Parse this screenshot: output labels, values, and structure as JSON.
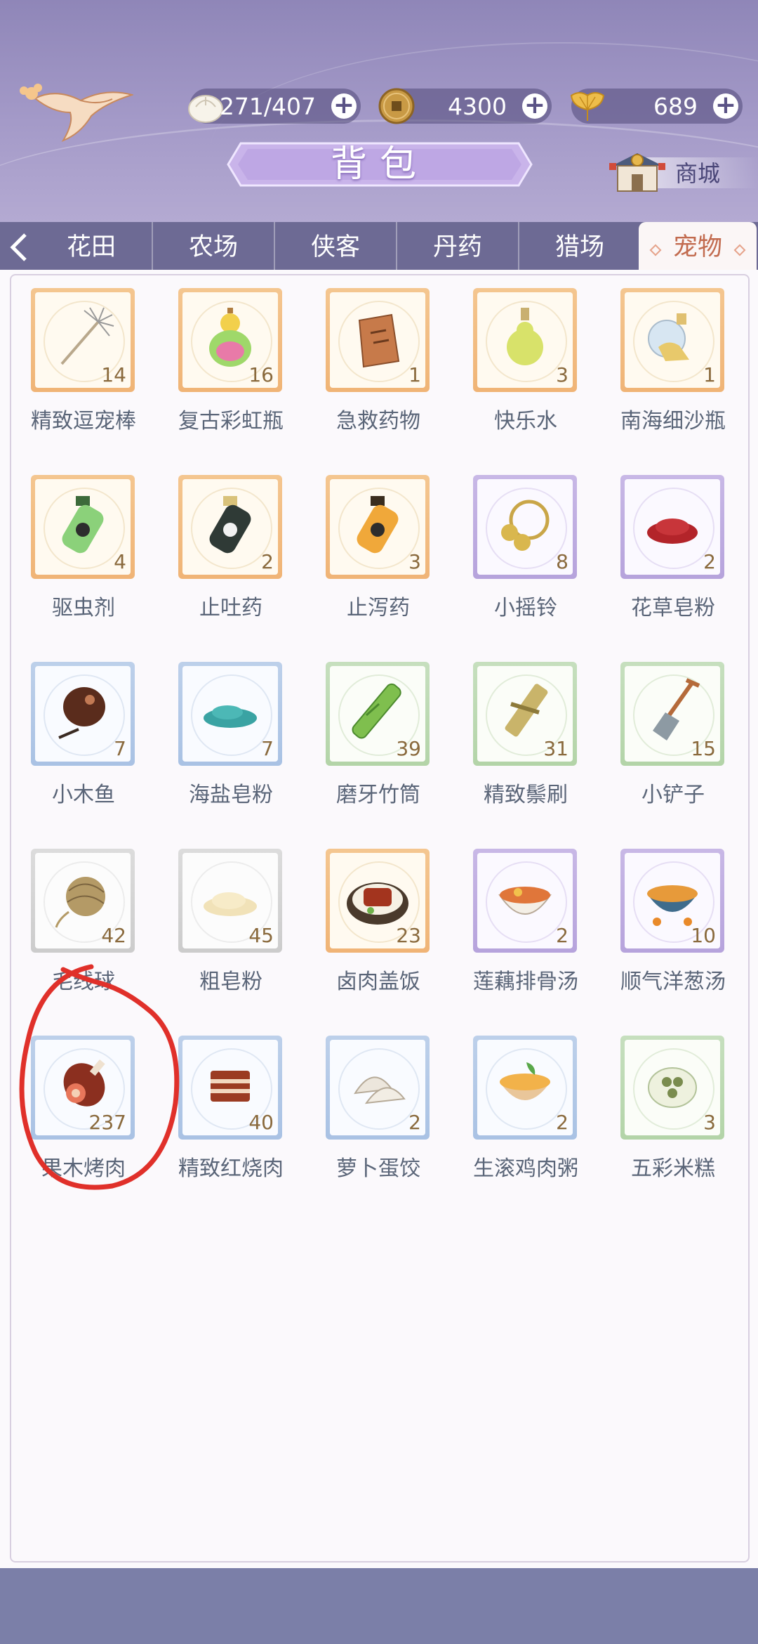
{
  "header": {
    "title": "背包",
    "shop_label": "商城",
    "resources": [
      {
        "icon": "bun-icon",
        "value": "271/407"
      },
      {
        "icon": "coin-icon",
        "value": "4300"
      },
      {
        "icon": "ginkgo-leaf-icon",
        "value": "689"
      }
    ]
  },
  "tabs": [
    {
      "label": "花田",
      "active": false
    },
    {
      "label": "农场",
      "active": false
    },
    {
      "label": "侠客",
      "active": false
    },
    {
      "label": "丹药",
      "active": false
    },
    {
      "label": "猎场",
      "active": false
    },
    {
      "label": "宠物",
      "active": true
    }
  ],
  "items": [
    {
      "name": "精致逗宠棒",
      "count": "14",
      "tier": "gold",
      "icon": "feather-wand-icon"
    },
    {
      "name": "复古彩虹瓶",
      "count": "16",
      "tier": "gold",
      "icon": "rainbow-gourd-icon"
    },
    {
      "name": "急救药物",
      "count": "1",
      "tier": "gold",
      "icon": "medicine-pack-icon"
    },
    {
      "name": "快乐水",
      "count": "3",
      "tier": "gold",
      "icon": "green-flask-icon"
    },
    {
      "name": "南海细沙瓶",
      "count": "1",
      "tier": "gold",
      "icon": "sand-bottle-icon"
    },
    {
      "name": "驱虫剂",
      "count": "4",
      "tier": "gold",
      "icon": "green-bottle-icon"
    },
    {
      "name": "止吐药",
      "count": "2",
      "tier": "gold",
      "icon": "black-bottle-icon"
    },
    {
      "name": "止泻药",
      "count": "3",
      "tier": "gold",
      "icon": "orange-bottle-icon"
    },
    {
      "name": "小摇铃",
      "count": "8",
      "tier": "purple",
      "icon": "bell-icon"
    },
    {
      "name": "花草皂粉",
      "count": "2",
      "tier": "purple",
      "icon": "red-powder-icon"
    },
    {
      "name": "小木鱼",
      "count": "7",
      "tier": "blue",
      "icon": "wooden-fish-icon"
    },
    {
      "name": "海盐皂粉",
      "count": "7",
      "tier": "blue",
      "icon": "teal-powder-icon"
    },
    {
      "name": "磨牙竹筒",
      "count": "39",
      "tier": "green",
      "icon": "bamboo-tube-icon"
    },
    {
      "name": "精致鬃刷",
      "count": "31",
      "tier": "green",
      "icon": "brush-icon"
    },
    {
      "name": "小铲子",
      "count": "15",
      "tier": "green",
      "icon": "shovel-icon"
    },
    {
      "name": "毛线球",
      "count": "42",
      "tier": "gray",
      "icon": "yarn-ball-icon"
    },
    {
      "name": "粗皂粉",
      "count": "45",
      "tier": "gray",
      "icon": "white-powder-icon"
    },
    {
      "name": "卤肉盖饭",
      "count": "23",
      "tier": "gold",
      "icon": "braised-pork-rice-icon"
    },
    {
      "name": "莲藕排骨汤",
      "count": "2",
      "tier": "purple",
      "icon": "soup-bowl-icon"
    },
    {
      "name": "顺气洋葱汤",
      "count": "10",
      "tier": "purple",
      "icon": "onion-soup-icon"
    },
    {
      "name": "果木烤肉",
      "count": "237",
      "tier": "blue",
      "icon": "roast-meat-icon"
    },
    {
      "name": "精致红烧肉",
      "count": "40",
      "tier": "blue",
      "icon": "braised-meat-icon"
    },
    {
      "name": "萝卜蛋饺",
      "count": "2",
      "tier": "blue",
      "icon": "dumplings-icon"
    },
    {
      "name": "生滚鸡肉粥",
      "count": "2",
      "tier": "blue",
      "icon": "congee-icon"
    },
    {
      "name": "五彩米糕",
      "count": "3",
      "tier": "green",
      "icon": "rice-cake-icon"
    }
  ],
  "colors": {
    "accent": "#c26b4f",
    "annotation": "#e0302a",
    "tab_bar": "#6d6a94"
  }
}
